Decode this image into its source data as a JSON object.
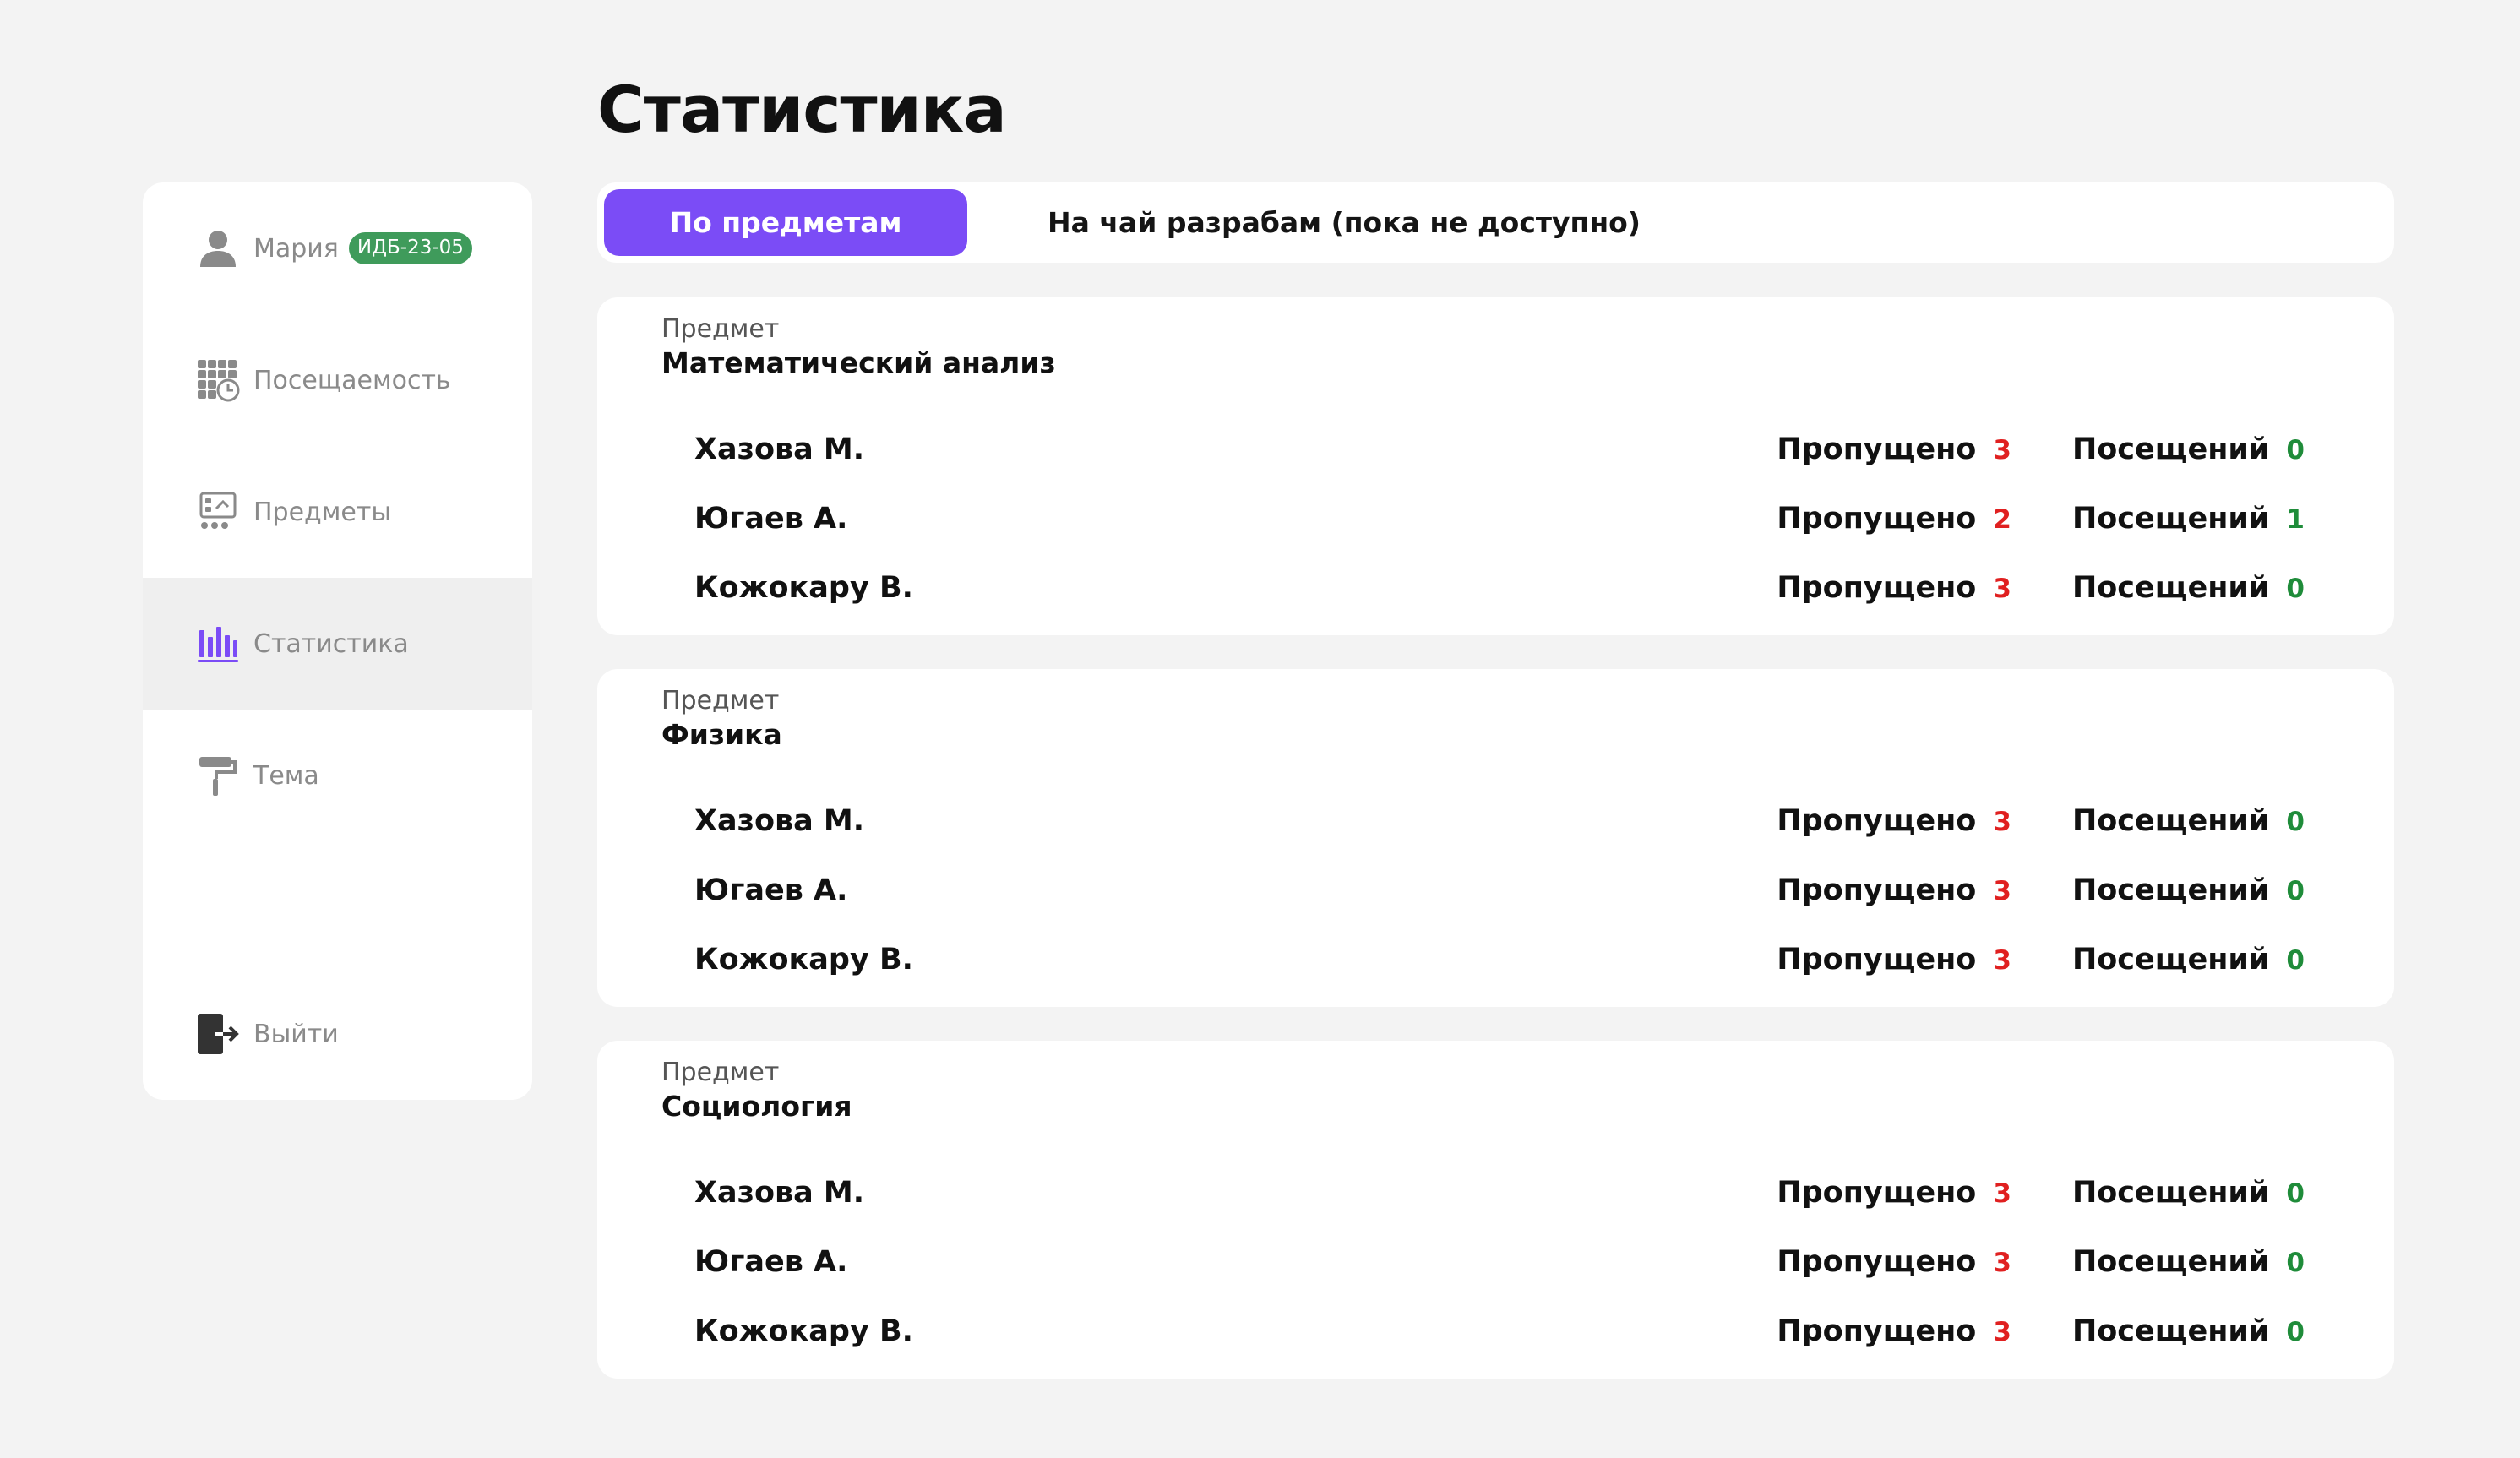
{
  "page_title": "Статистика",
  "user": {
    "name": "Мария",
    "group": "ИДБ-23-05"
  },
  "sidebar": {
    "items": [
      {
        "label": "Посещаемость",
        "icon": "attendance-grid-clock-icon"
      },
      {
        "label": "Предметы",
        "icon": "subjects-board-icon"
      },
      {
        "label": "Статистика",
        "icon": "bar-chart-icon",
        "active": true
      },
      {
        "label": "Тема",
        "icon": "paint-roller-icon"
      }
    ],
    "logout": {
      "label": "Выйти",
      "icon": "logout-icon"
    }
  },
  "tabs": [
    {
      "label": "По предметам",
      "active": true
    },
    {
      "label": "На чай разрабам (пока не доступно)",
      "active": false
    }
  ],
  "stat_labels": {
    "missed": "Пропущено",
    "visits": "Посещений"
  },
  "subjects": [
    {
      "label": "Предмет",
      "title": "Математический анализ",
      "rows": [
        {
          "name": "Хазова М.",
          "missed": "3",
          "visits": "0"
        },
        {
          "name": "Югаев А.",
          "missed": "2",
          "visits": "1"
        },
        {
          "name": "Кожокару В.",
          "missed": "3",
          "visits": "0"
        }
      ]
    },
    {
      "label": "Предмет",
      "title": "Физика",
      "rows": [
        {
          "name": "Хазова М.",
          "missed": "3",
          "visits": "0"
        },
        {
          "name": "Югаев А.",
          "missed": "3",
          "visits": "0"
        },
        {
          "name": "Кожокару В.",
          "missed": "3",
          "visits": "0"
        }
      ]
    },
    {
      "label": "Предмет",
      "title": "Социология",
      "rows": [
        {
          "name": "Хазова М.",
          "missed": "3",
          "visits": "0"
        },
        {
          "name": "Югаев А.",
          "missed": "3",
          "visits": "0"
        },
        {
          "name": "Кожокару В.",
          "missed": "3",
          "visits": "0"
        }
      ]
    }
  ],
  "colors": {
    "accent": "#7b4cf6",
    "badge": "#3f9b5b",
    "missed": "#e02020",
    "visits": "#1f8c3a"
  }
}
